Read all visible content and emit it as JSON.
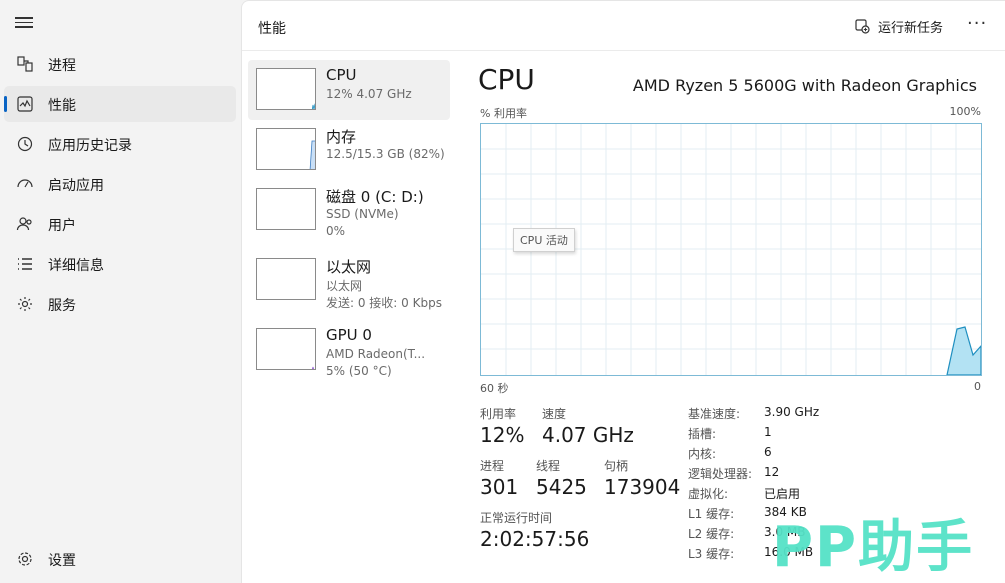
{
  "nav": {
    "items": [
      {
        "label": "进程",
        "icon": "processes-icon"
      },
      {
        "label": "性能",
        "icon": "performance-icon",
        "active": true
      },
      {
        "label": "应用历史记录",
        "icon": "history-icon"
      },
      {
        "label": "启动应用",
        "icon": "startup-icon"
      },
      {
        "label": "用户",
        "icon": "users-icon"
      },
      {
        "label": "详细信息",
        "icon": "details-icon"
      },
      {
        "label": "服务",
        "icon": "services-icon"
      }
    ],
    "settings_label": "设置"
  },
  "header": {
    "title": "性能",
    "run_task_label": "运行新任务",
    "more_label": "···"
  },
  "devices": [
    {
      "name": "CPU",
      "line1": "12% 4.07 GHz",
      "line2": ""
    },
    {
      "name": "内存",
      "line1": "12.5/15.3 GB (82%)",
      "line2": ""
    },
    {
      "name": "磁盘 0 (C: D:)",
      "line1": "SSD (NVMe)",
      "line2": "0%"
    },
    {
      "name": "以太网",
      "line1": "以太网",
      "line2": "发送: 0 接收: 0 Kbps"
    },
    {
      "name": "GPU 0",
      "line1": "AMD Radeon(T...",
      "line2": "5% (50 °C)"
    }
  ],
  "detail": {
    "title": "CPU",
    "model": "AMD Ryzen 5 5600G with Radeon Graphics",
    "y_label": "% 利用率",
    "y_max_label": "100%",
    "x_left_label": "60 秒",
    "x_right_label": "0",
    "tooltip": "CPU 活动",
    "stats": {
      "util_label": "利用率",
      "util_value": "12%",
      "speed_label": "速度",
      "speed_value": "4.07 GHz",
      "proc_label": "进程",
      "proc_value": "301",
      "thread_label": "线程",
      "thread_value": "5425",
      "handle_label": "句柄",
      "handle_value": "173904",
      "uptime_label": "正常运行时间",
      "uptime_value": "2:02:57:56"
    },
    "specs": [
      {
        "k": "基准速度:",
        "v": "3.90 GHz"
      },
      {
        "k": "插槽:",
        "v": "1"
      },
      {
        "k": "内核:",
        "v": "6"
      },
      {
        "k": "逻辑处理器:",
        "v": "12"
      },
      {
        "k": "虚拟化:",
        "v": "已启用"
      },
      {
        "k": "L1 缓存:",
        "v": "384 KB"
      },
      {
        "k": "L2 缓存:",
        "v": "3.0 MB"
      },
      {
        "k": "L3 缓存:",
        "v": "16.0 MB"
      }
    ]
  },
  "watermark": "PP助手",
  "colors": {
    "accent": "#0a64c4",
    "graph_line": "#1f8fc0",
    "graph_fill": "#b3e2f3",
    "grid": "#e3eef3",
    "watermark": "#55e2c7"
  }
}
